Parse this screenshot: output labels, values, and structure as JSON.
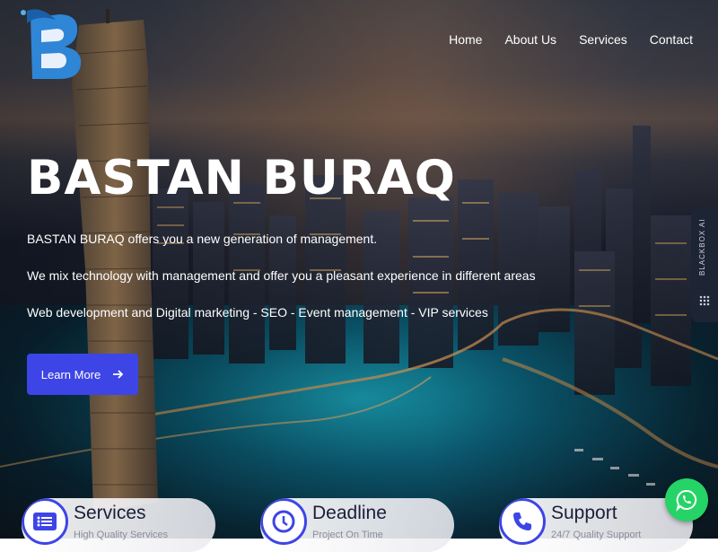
{
  "brand": {
    "logo_letter": "B",
    "accent": "#3d45e6",
    "logo_blue": "#2f86d6"
  },
  "nav": {
    "items": [
      "Home",
      "About Us",
      "Services",
      "Contact"
    ]
  },
  "hero": {
    "title": "BASTAN BURAQ",
    "line1": "BASTAN BURAQ offers you a new generation of management.",
    "line2": "We mix technology with management and offer you a pleasant experience in different areas",
    "line3": "Web development and Digital marketing - SEO - Event management - VIP services",
    "cta_label": "Learn More",
    "cta_icon": "arrow-right-icon"
  },
  "features": [
    {
      "title": "Services",
      "subtitle": "High Quality Services",
      "icon": "list-icon"
    },
    {
      "title": "Deadline",
      "subtitle": "Project On Time",
      "icon": "clock-icon"
    },
    {
      "title": "Support",
      "subtitle": "24/7 Quality Support",
      "icon": "phone-icon"
    }
  ],
  "side_widget": {
    "label": "BLACKBOX AI"
  },
  "chat": {
    "icon": "whatsapp-icon",
    "color": "#25d366"
  }
}
